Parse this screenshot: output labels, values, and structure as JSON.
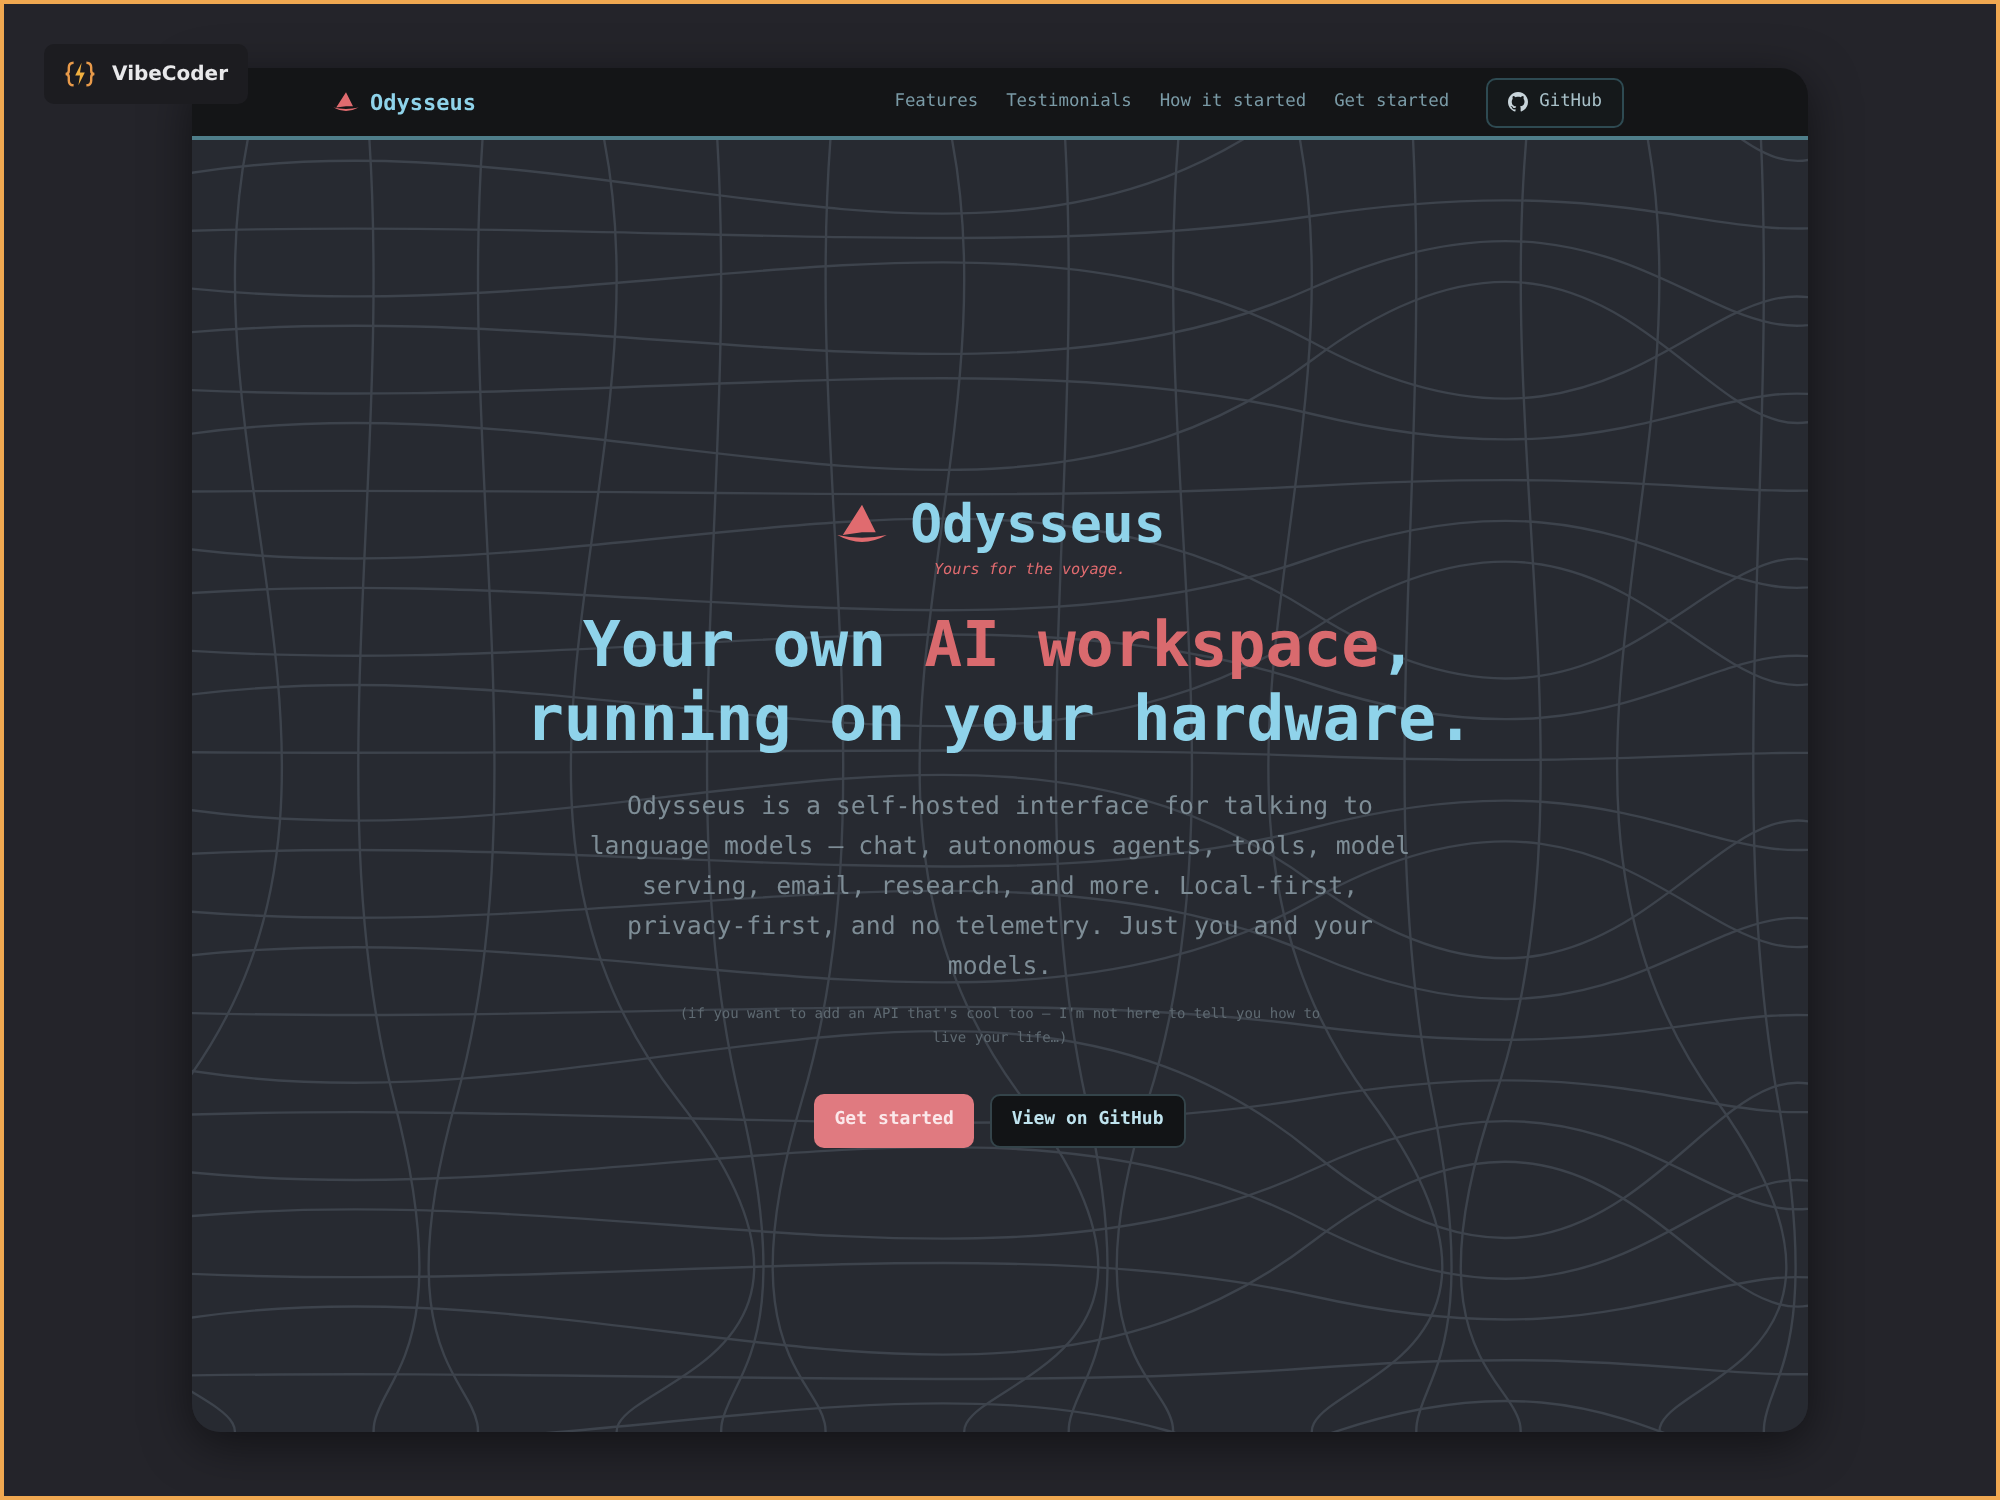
{
  "badge": {
    "label": "VibeCoder"
  },
  "nav": {
    "brand": "Odysseus",
    "links": [
      "Features",
      "Testimonials",
      "How it started",
      "Get started"
    ],
    "github": "GitHub"
  },
  "hero": {
    "brand": "Odysseus",
    "tagline": "Yours for the voyage.",
    "headline": [
      [
        {
          "text": "Your own ",
          "accent": false
        },
        {
          "text": "AI workspace",
          "accent": true
        },
        {
          "text": ",",
          "accent": false
        }
      ],
      [
        {
          "text": "running on your hardware.",
          "accent": false
        }
      ]
    ],
    "description": "Odysseus is a self-hosted interface for talking to language models — chat, autonomous agents, tools, model serving, email, research, and more. Local-first, privacy-first, and no telemetry. Just you and your models.",
    "note": "(if you want to add an API that's cool too — I'm not here to tell you how to live your life…)",
    "buttons": [
      {
        "label": "Get started",
        "kind": "primary"
      },
      {
        "label": "View on GitHub",
        "kind": "secondary"
      }
    ]
  }
}
